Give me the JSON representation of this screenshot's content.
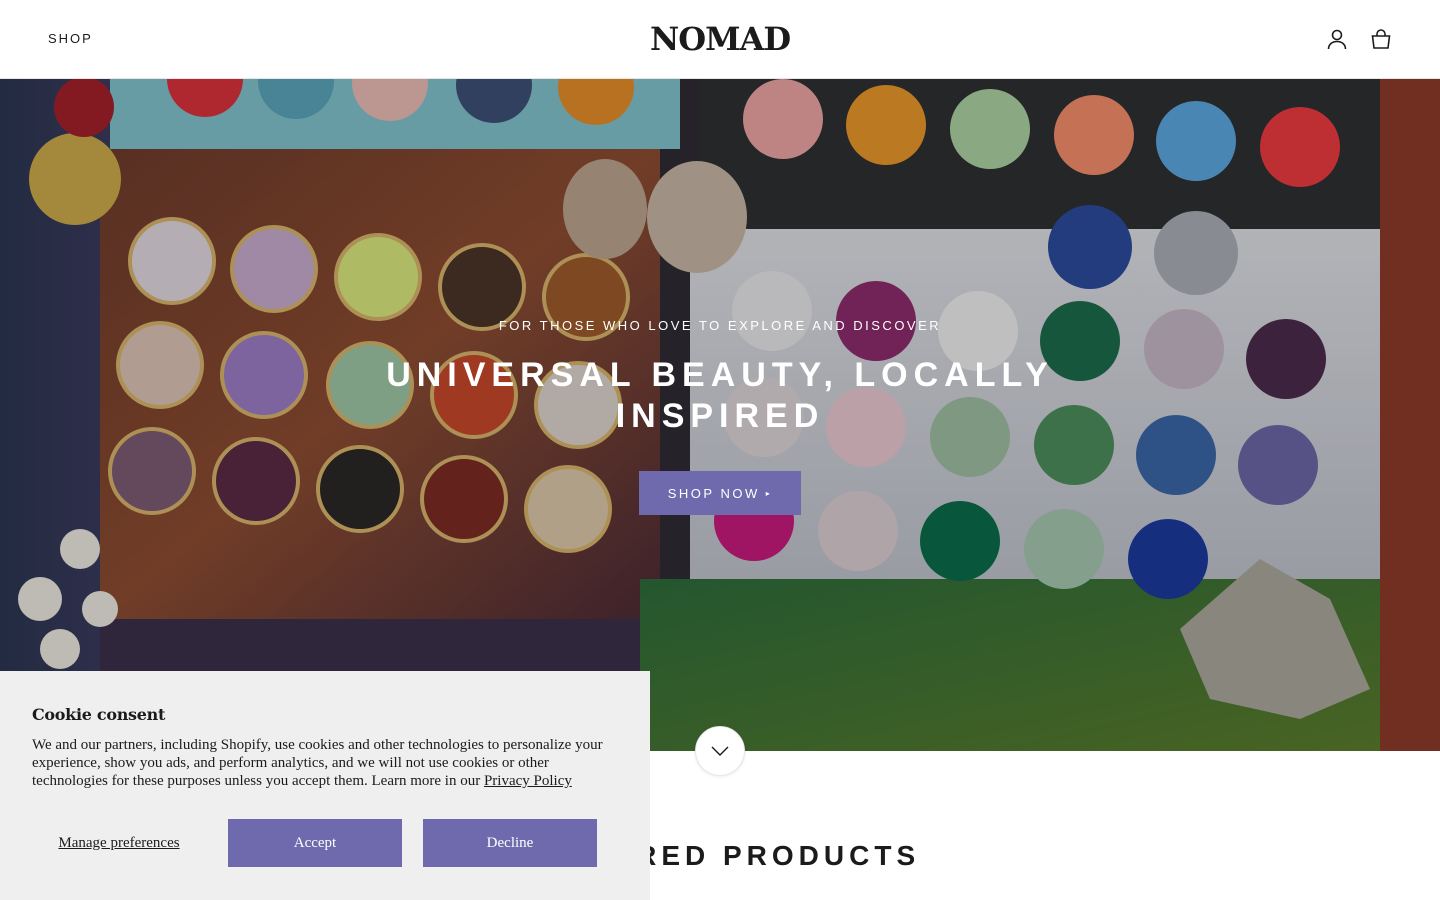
{
  "header": {
    "nav_shop": "SHOP",
    "logo": "NOMAD",
    "icons": [
      "account-icon",
      "cart-icon"
    ]
  },
  "hero": {
    "subtitle": "FOR THOSE WHO LOVE TO EXPLORE AND DISCOVER",
    "title": "UNIVERSAL BEAUTY, LOCALLY INSPIRED",
    "cta_label": "SHOP NOW",
    "cta_arrow": "▸",
    "scroll_icon": "chevron-down-icon"
  },
  "featured": {
    "title": "FEATURED PRODUCTS"
  },
  "cookie": {
    "title": "Cookie consent",
    "text": "We and our partners, including Shopify, use cookies and other technologies to personalize your experience, show you ads, and perform analytics, and we will not use cookies or other technologies for these purposes unless you accept them. Learn more in our ",
    "link_label": "Privacy Policy",
    "manage_label": "Manage preferences",
    "accept_label": "Accept",
    "decline_label": "Decline"
  },
  "colors": {
    "accent": "#6f6aae",
    "text": "#1c1b1b",
    "cookie_bg": "#f0efef"
  }
}
